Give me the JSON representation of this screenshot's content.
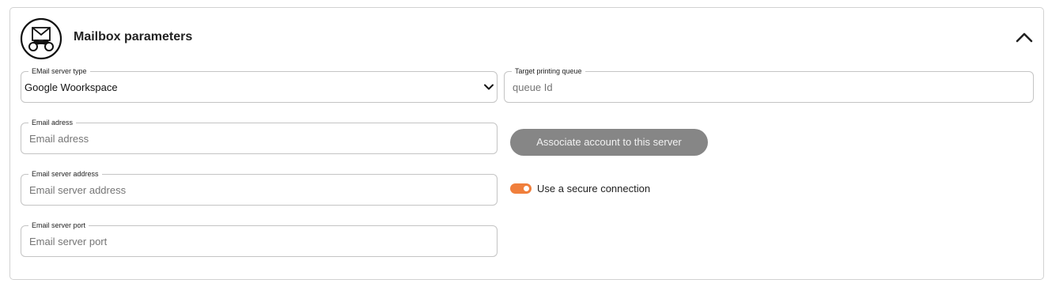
{
  "panel": {
    "title": "Mailbox parameters",
    "header_icon": "mailbox-binoculars-icon",
    "collapse_icon": "chevron-up-icon"
  },
  "email_server_type": {
    "label": "EMail server type",
    "value": "Google Woorkspace",
    "icon": "chevron-down-icon"
  },
  "target_queue": {
    "label": "Target printing queue",
    "placeholder": "queue Id",
    "value": ""
  },
  "email_address": {
    "label": "Email adress",
    "placeholder": "Email adress",
    "value": ""
  },
  "server_address": {
    "label": "Email server address",
    "placeholder": "Email server address",
    "value": ""
  },
  "server_port": {
    "label": "Email server port",
    "placeholder": "Email server port",
    "value": ""
  },
  "associate_button": {
    "label": "Associate account to this server",
    "enabled": false
  },
  "secure_connection": {
    "label": "Use a secure connection",
    "enabled": true
  },
  "colors": {
    "accent": "#f07f3c",
    "disabled_button": "#868686",
    "border": "#c4c4c4"
  }
}
